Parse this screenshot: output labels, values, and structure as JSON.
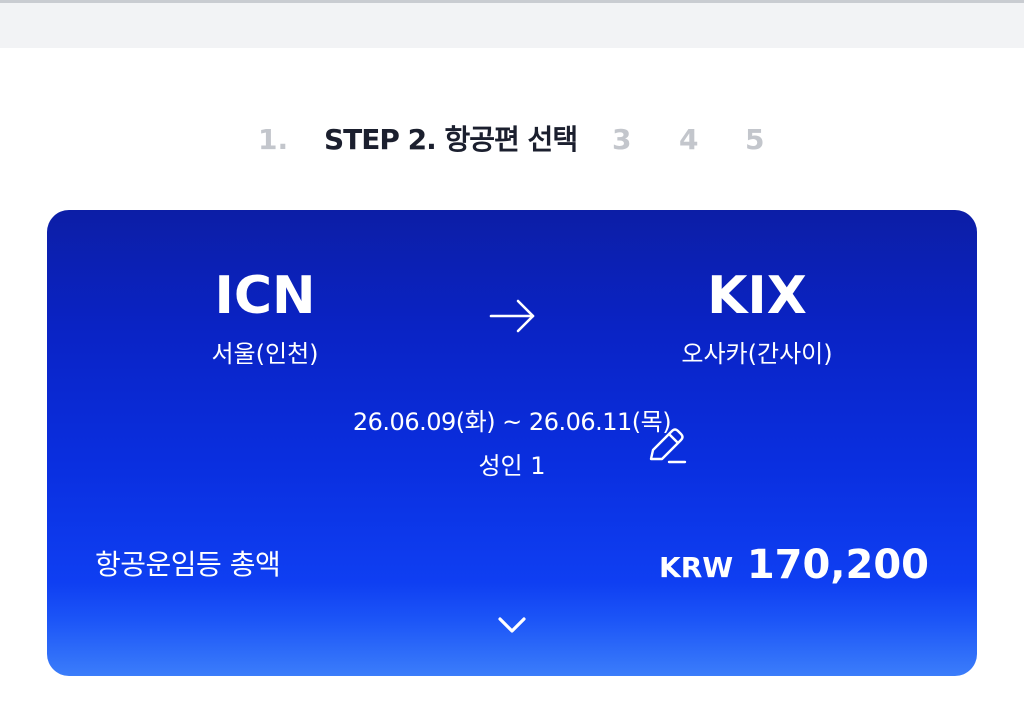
{
  "steps": {
    "step1": "1.",
    "current": "STEP 2. 항공편 선택",
    "step3": "3",
    "step4": "4",
    "step5": "5"
  },
  "flight": {
    "origin_code": "ICN",
    "origin_name": "서울(인천)",
    "destination_code": "KIX",
    "destination_name": "오사카(간사이)",
    "dates": "26.06.09(화) ~ 26.06.11(목)",
    "passengers": "성인 1"
  },
  "fare": {
    "label": "항공운임등 총액",
    "currency": "KRW",
    "amount": "170,200"
  },
  "icons": {
    "arrow": "arrow-right-icon",
    "edit": "pencil-edit-icon",
    "expand": "chevron-down-icon"
  },
  "colors": {
    "card_top": "#0c1ea6",
    "card_bottom": "#3b7dfa",
    "active_step": "#1b1f2e",
    "inactive_step": "#c3c6cc"
  }
}
